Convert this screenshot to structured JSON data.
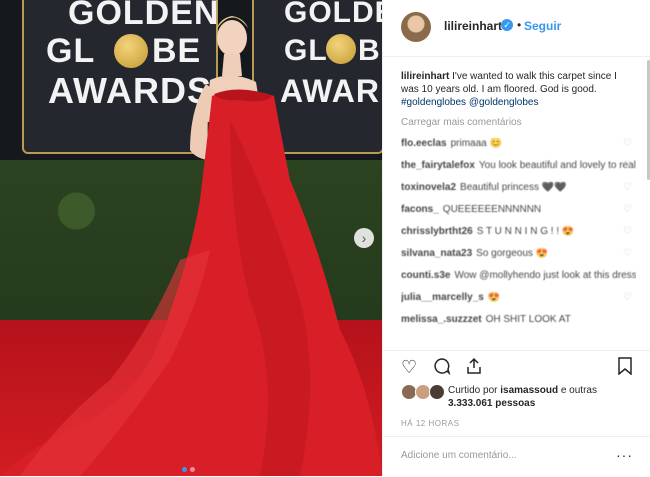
{
  "photo": {
    "panel_left": {
      "line1": "GOLDEN",
      "line2": "GL",
      "line2_after": "BE",
      "line3": "AWARDS"
    },
    "panel_right": {
      "line1": "GOLDEN",
      "line2": "GL",
      "line2_after": "BE",
      "line3": "AWARDS"
    },
    "next_icon": "chevron-right-icon",
    "slide_count": 2,
    "active_slide": 1
  },
  "header": {
    "username": "lilireinhart",
    "follow_label": "Seguir"
  },
  "caption": {
    "username": "lilireinhart",
    "text": "I've wanted to walk this carpet since I was 10 years old. I am floored. God is good.",
    "hashtags": "#goldenglobes @goldenglobes"
  },
  "load_more": "Carregar mais comentários",
  "comments": [
    {
      "user": "flo.eeclas",
      "text": "primaaa 😊"
    },
    {
      "user": "the_fairytalefox",
      "text": "You look beautiful and lovely to realize a dream 💗"
    },
    {
      "user": "toxinovela2",
      "text": "Beautiful princess 🖤🖤"
    },
    {
      "user": "facons_",
      "text": "QUEEEEEENNNNNN"
    },
    {
      "user": "chrisslybrtht26",
      "text": "S T U N N I N G ! ! 😍"
    },
    {
      "user": "silvana_nata23",
      "text": "So gorgeous 😍"
    },
    {
      "user": "counti.s3e",
      "text": "Wow @mollyhendo just look at this dress 😍😍"
    },
    {
      "user": "julia__marcelly_s",
      "text": "😍"
    },
    {
      "user": "melissa_.suzzzet",
      "text": "OH SHIT LOOK AT"
    }
  ],
  "likes": {
    "prefix": "Curtido por",
    "user": "isamassoud",
    "middle": "e outras",
    "count": "3.333.061",
    "suffix": "pessoas"
  },
  "time": "HÁ 12 HORAS",
  "comment_input": {
    "placeholder": "Adicione um comentário..."
  },
  "colors": {
    "accent": "#3897f0",
    "red_dress": "#d91e26"
  }
}
